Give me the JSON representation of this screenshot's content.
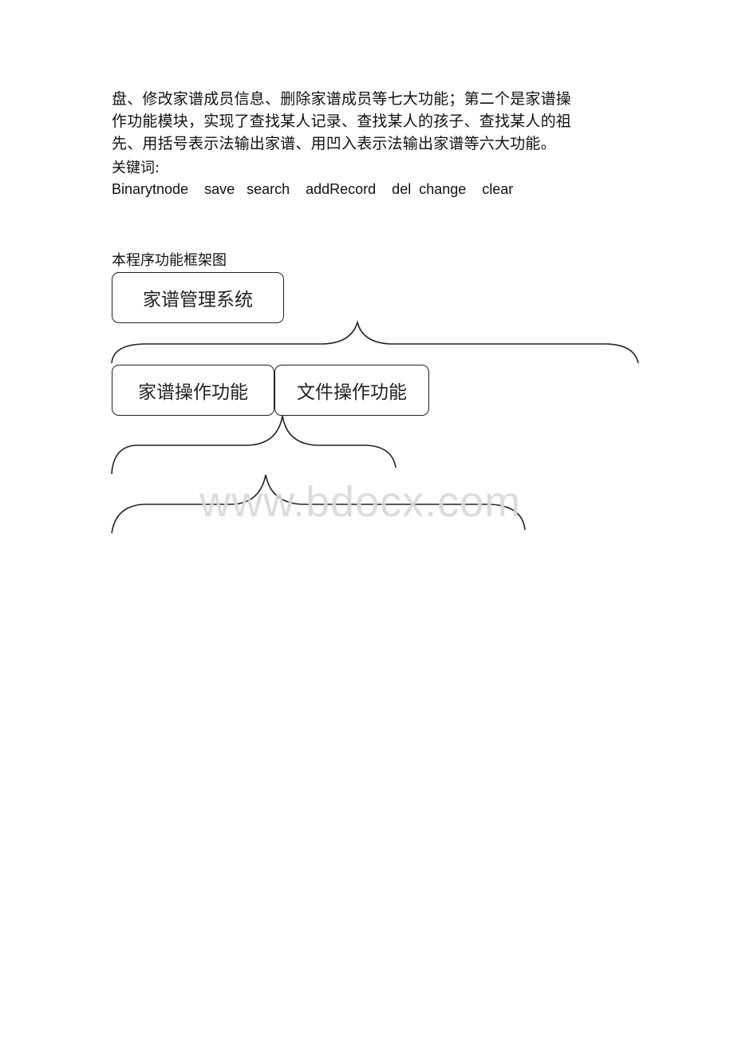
{
  "paragraph": {
    "lines": [
      "盘、修改家谱成员信息、删除家谱成员等七大功能；第二个是家谱操",
      "作功能模块，实现了查找某人记录、查找某人的孩子、查找某人的祖",
      "先、用括号表示法输出家谱、用凹入表示法输出家谱等六大功能。"
    ]
  },
  "keywords_label": "关键词:",
  "keywords": "Binarytnode    save   search    addRecord    del  change    clear",
  "diagram": {
    "caption": "本程序功能框架图",
    "root": "家谱管理系统",
    "children": [
      "家谱操作功能",
      "文件操作功能"
    ]
  },
  "watermark": "www.bdocx.com"
}
